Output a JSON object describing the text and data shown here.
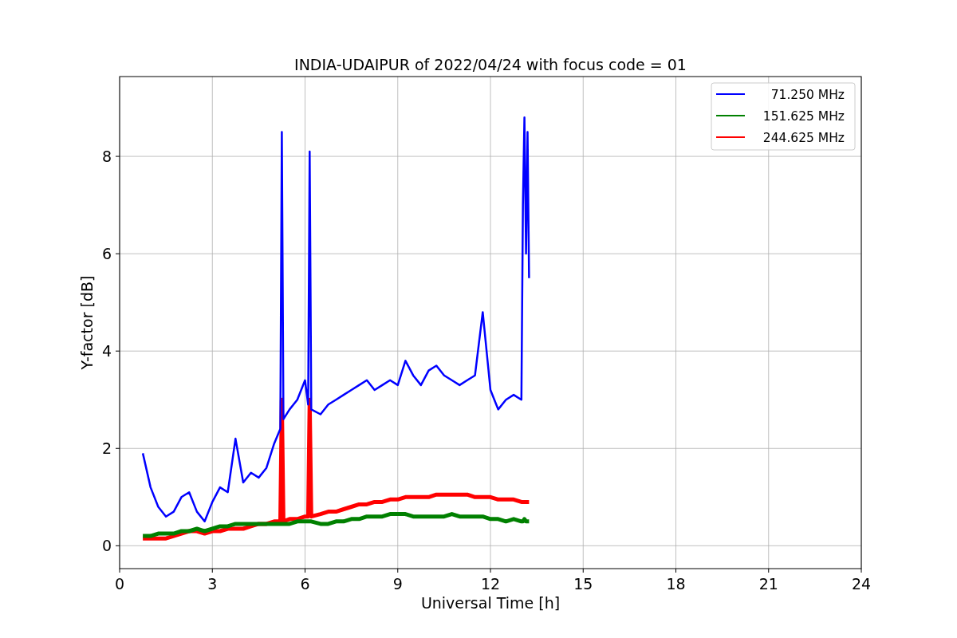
{
  "chart_data": {
    "type": "line",
    "title": "INDIA-UDAIPUR of 2022/04/24 with focus code = 01",
    "xlabel": "Universal Time [h]",
    "ylabel": "Y-factor [dB]",
    "xlim": [
      0,
      24
    ],
    "ylim": [
      -0.47,
      9.64
    ],
    "xticks": [
      0,
      3,
      6,
      9,
      12,
      15,
      18,
      21,
      24
    ],
    "yticks": [
      0,
      2,
      4,
      6,
      8
    ],
    "grid": true,
    "legend": "upper right",
    "x": [
      0.75,
      1.0,
      1.25,
      1.5,
      1.75,
      2.0,
      2.25,
      2.5,
      2.75,
      3.0,
      3.25,
      3.5,
      3.75,
      4.0,
      4.25,
      4.5,
      4.75,
      5.0,
      5.2,
      5.25,
      5.3,
      5.5,
      5.75,
      6.0,
      6.1,
      6.15,
      6.2,
      6.5,
      6.75,
      7.0,
      7.25,
      7.5,
      7.75,
      8.0,
      8.25,
      8.5,
      8.75,
      9.0,
      9.25,
      9.5,
      9.75,
      10.0,
      10.25,
      10.5,
      10.75,
      11.0,
      11.25,
      11.5,
      11.75,
      12.0,
      12.25,
      12.5,
      12.75,
      13.0,
      13.05,
      13.1,
      13.15,
      13.2,
      13.25
    ],
    "series": [
      {
        "name": "71.250 MHz",
        "color": "#0000ff",
        "values": [
          1.9,
          1.2,
          0.8,
          0.6,
          0.7,
          1.0,
          1.1,
          0.7,
          0.5,
          0.9,
          1.2,
          1.1,
          2.2,
          1.3,
          1.5,
          1.4,
          1.6,
          2.1,
          2.4,
          8.5,
          2.6,
          2.8,
          3.0,
          3.4,
          2.9,
          8.1,
          2.8,
          2.7,
          2.9,
          3.0,
          3.1,
          3.2,
          3.3,
          3.4,
          3.2,
          3.3,
          3.4,
          3.3,
          3.8,
          3.5,
          3.3,
          3.6,
          3.7,
          3.5,
          3.4,
          3.3,
          3.4,
          3.5,
          4.8,
          3.2,
          2.8,
          3.0,
          3.1,
          3.0,
          7.0,
          8.8,
          6.0,
          8.5,
          5.5
        ]
      },
      {
        "name": "151.625 MHz",
        "color": "#008000",
        "values": [
          0.2,
          0.2,
          0.25,
          0.25,
          0.25,
          0.3,
          0.3,
          0.35,
          0.3,
          0.35,
          0.4,
          0.4,
          0.45,
          0.45,
          0.45,
          0.45,
          0.45,
          0.45,
          0.45,
          0.45,
          0.45,
          0.45,
          0.5,
          0.5,
          0.5,
          0.5,
          0.5,
          0.45,
          0.45,
          0.5,
          0.5,
          0.55,
          0.55,
          0.6,
          0.6,
          0.6,
          0.65,
          0.65,
          0.65,
          0.6,
          0.6,
          0.6,
          0.6,
          0.6,
          0.65,
          0.6,
          0.6,
          0.6,
          0.6,
          0.55,
          0.55,
          0.5,
          0.55,
          0.5,
          0.5,
          0.55,
          0.5,
          0.5,
          0.5
        ]
      },
      {
        "name": "244.625 MHz",
        "color": "#ff0000",
        "values": [
          0.15,
          0.15,
          0.15,
          0.15,
          0.2,
          0.25,
          0.3,
          0.3,
          0.25,
          0.3,
          0.3,
          0.35,
          0.35,
          0.35,
          0.4,
          0.45,
          0.45,
          0.5,
          0.5,
          3.0,
          0.5,
          0.55,
          0.55,
          0.6,
          0.6,
          3.0,
          0.6,
          0.65,
          0.7,
          0.7,
          0.75,
          0.8,
          0.85,
          0.85,
          0.9,
          0.9,
          0.95,
          0.95,
          1.0,
          1.0,
          1.0,
          1.0,
          1.05,
          1.05,
          1.05,
          1.05,
          1.05,
          1.0,
          1.0,
          1.0,
          0.95,
          0.95,
          0.95,
          0.9,
          0.9,
          0.9,
          0.9,
          0.9,
          0.9
        ]
      }
    ]
  }
}
